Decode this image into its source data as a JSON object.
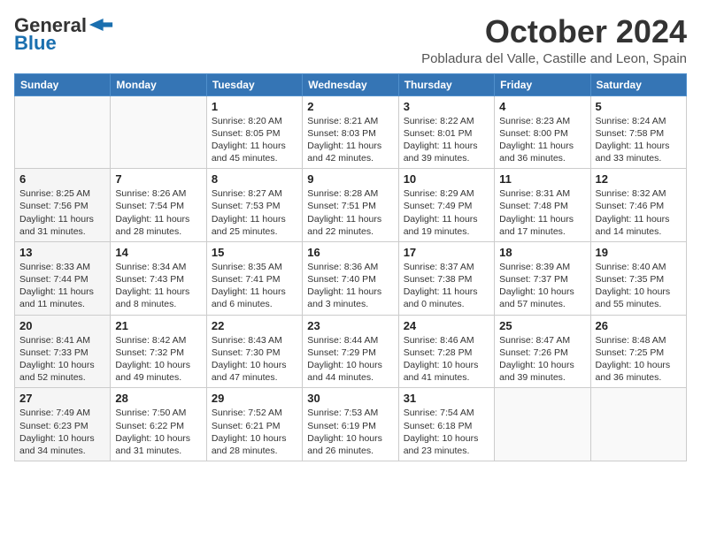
{
  "logo": {
    "general": "General",
    "blue": "Blue",
    "arrow_color": "#1a6faf"
  },
  "header": {
    "title": "October 2024",
    "subtitle": "Pobladura del Valle, Castille and Leon, Spain"
  },
  "columns": [
    "Sunday",
    "Monday",
    "Tuesday",
    "Wednesday",
    "Thursday",
    "Friday",
    "Saturday"
  ],
  "weeks": [
    [
      {
        "day": "",
        "info": ""
      },
      {
        "day": "",
        "info": ""
      },
      {
        "day": "1",
        "info": "Sunrise: 8:20 AM\nSunset: 8:05 PM\nDaylight: 11 hours and 45 minutes."
      },
      {
        "day": "2",
        "info": "Sunrise: 8:21 AM\nSunset: 8:03 PM\nDaylight: 11 hours and 42 minutes."
      },
      {
        "day": "3",
        "info": "Sunrise: 8:22 AM\nSunset: 8:01 PM\nDaylight: 11 hours and 39 minutes."
      },
      {
        "day": "4",
        "info": "Sunrise: 8:23 AM\nSunset: 8:00 PM\nDaylight: 11 hours and 36 minutes."
      },
      {
        "day": "5",
        "info": "Sunrise: 8:24 AM\nSunset: 7:58 PM\nDaylight: 11 hours and 33 minutes."
      }
    ],
    [
      {
        "day": "6",
        "info": "Sunrise: 8:25 AM\nSunset: 7:56 PM\nDaylight: 11 hours and 31 minutes."
      },
      {
        "day": "7",
        "info": "Sunrise: 8:26 AM\nSunset: 7:54 PM\nDaylight: 11 hours and 28 minutes."
      },
      {
        "day": "8",
        "info": "Sunrise: 8:27 AM\nSunset: 7:53 PM\nDaylight: 11 hours and 25 minutes."
      },
      {
        "day": "9",
        "info": "Sunrise: 8:28 AM\nSunset: 7:51 PM\nDaylight: 11 hours and 22 minutes."
      },
      {
        "day": "10",
        "info": "Sunrise: 8:29 AM\nSunset: 7:49 PM\nDaylight: 11 hours and 19 minutes."
      },
      {
        "day": "11",
        "info": "Sunrise: 8:31 AM\nSunset: 7:48 PM\nDaylight: 11 hours and 17 minutes."
      },
      {
        "day": "12",
        "info": "Sunrise: 8:32 AM\nSunset: 7:46 PM\nDaylight: 11 hours and 14 minutes."
      }
    ],
    [
      {
        "day": "13",
        "info": "Sunrise: 8:33 AM\nSunset: 7:44 PM\nDaylight: 11 hours and 11 minutes."
      },
      {
        "day": "14",
        "info": "Sunrise: 8:34 AM\nSunset: 7:43 PM\nDaylight: 11 hours and 8 minutes."
      },
      {
        "day": "15",
        "info": "Sunrise: 8:35 AM\nSunset: 7:41 PM\nDaylight: 11 hours and 6 minutes."
      },
      {
        "day": "16",
        "info": "Sunrise: 8:36 AM\nSunset: 7:40 PM\nDaylight: 11 hours and 3 minutes."
      },
      {
        "day": "17",
        "info": "Sunrise: 8:37 AM\nSunset: 7:38 PM\nDaylight: 11 hours and 0 minutes."
      },
      {
        "day": "18",
        "info": "Sunrise: 8:39 AM\nSunset: 7:37 PM\nDaylight: 10 hours and 57 minutes."
      },
      {
        "day": "19",
        "info": "Sunrise: 8:40 AM\nSunset: 7:35 PM\nDaylight: 10 hours and 55 minutes."
      }
    ],
    [
      {
        "day": "20",
        "info": "Sunrise: 8:41 AM\nSunset: 7:33 PM\nDaylight: 10 hours and 52 minutes."
      },
      {
        "day": "21",
        "info": "Sunrise: 8:42 AM\nSunset: 7:32 PM\nDaylight: 10 hours and 49 minutes."
      },
      {
        "day": "22",
        "info": "Sunrise: 8:43 AM\nSunset: 7:30 PM\nDaylight: 10 hours and 47 minutes."
      },
      {
        "day": "23",
        "info": "Sunrise: 8:44 AM\nSunset: 7:29 PM\nDaylight: 10 hours and 44 minutes."
      },
      {
        "day": "24",
        "info": "Sunrise: 8:46 AM\nSunset: 7:28 PM\nDaylight: 10 hours and 41 minutes."
      },
      {
        "day": "25",
        "info": "Sunrise: 8:47 AM\nSunset: 7:26 PM\nDaylight: 10 hours and 39 minutes."
      },
      {
        "day": "26",
        "info": "Sunrise: 8:48 AM\nSunset: 7:25 PM\nDaylight: 10 hours and 36 minutes."
      }
    ],
    [
      {
        "day": "27",
        "info": "Sunrise: 7:49 AM\nSunset: 6:23 PM\nDaylight: 10 hours and 34 minutes."
      },
      {
        "day": "28",
        "info": "Sunrise: 7:50 AM\nSunset: 6:22 PM\nDaylight: 10 hours and 31 minutes."
      },
      {
        "day": "29",
        "info": "Sunrise: 7:52 AM\nSunset: 6:21 PM\nDaylight: 10 hours and 28 minutes."
      },
      {
        "day": "30",
        "info": "Sunrise: 7:53 AM\nSunset: 6:19 PM\nDaylight: 10 hours and 26 minutes."
      },
      {
        "day": "31",
        "info": "Sunrise: 7:54 AM\nSunset: 6:18 PM\nDaylight: 10 hours and 23 minutes."
      },
      {
        "day": "",
        "info": ""
      },
      {
        "day": "",
        "info": ""
      }
    ]
  ]
}
